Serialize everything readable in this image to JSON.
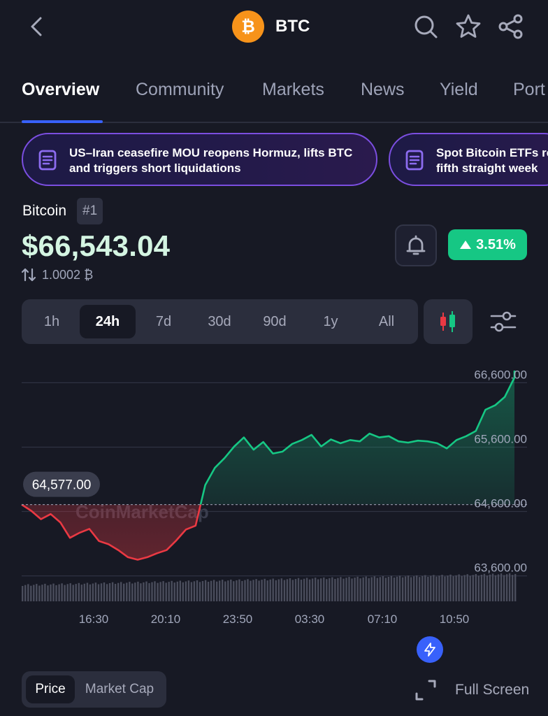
{
  "header": {
    "coin_symbol": "BTC",
    "icons": [
      "back-arrow-icon",
      "bitcoin-logo-icon",
      "search-icon",
      "star-icon",
      "share-icon"
    ]
  },
  "tabs": [
    {
      "label": "Overview",
      "active": true
    },
    {
      "label": "Community"
    },
    {
      "label": "Markets"
    },
    {
      "label": "News"
    },
    {
      "label": "Yield"
    },
    {
      "label": "Port"
    }
  ],
  "news": [
    {
      "line1": "US–Iran ceasefire MOU reopens Hormuz, lifts BTC",
      "line2": "and triggers short liquidations"
    },
    {
      "line1": "Spot Bitcoin ETFs re",
      "line2": "fifth straight week"
    }
  ],
  "coin": {
    "name": "Bitcoin",
    "rank": "#1",
    "price": "$66,543.04",
    "btc_value": "1.0002 ₿",
    "change": "3.51%",
    "change_color": "#16c784"
  },
  "ranges": [
    {
      "label": "1h"
    },
    {
      "label": "24h",
      "active": true
    },
    {
      "label": "7d"
    },
    {
      "label": "30d"
    },
    {
      "label": "90d"
    },
    {
      "label": "1y"
    },
    {
      "label": "All"
    }
  ],
  "chart": {
    "watermark": "CoinMarketCap",
    "marker_label": "64,577.00",
    "ylabels": [
      "66,600.00",
      "65,600.00",
      "64,600.00",
      "63,600.00"
    ],
    "xlabels": [
      "16:30",
      "20:10",
      "23:50",
      "03:30",
      "07:10",
      "10:50"
    ]
  },
  "chart_data": {
    "type": "line",
    "title": "",
    "xlabel": "",
    "ylabel": "",
    "ylim": [
      63400,
      66800
    ],
    "baseline": 64577,
    "up_color": "#16c784",
    "down_color": "#ea3943",
    "x": [
      "14:00",
      "14:30",
      "15:00",
      "15:30",
      "16:00",
      "16:30",
      "17:00",
      "17:30",
      "18:00",
      "18:30",
      "19:00",
      "19:30",
      "20:00",
      "20:10",
      "20:30",
      "21:00",
      "21:30",
      "22:00",
      "22:20",
      "22:30",
      "23:00",
      "23:30",
      "23:50",
      "00:30",
      "01:00",
      "01:30",
      "02:00",
      "02:30",
      "03:00",
      "03:30",
      "04:00",
      "04:30",
      "05:00",
      "05:30",
      "06:00",
      "06:30",
      "07:00",
      "07:10",
      "07:30",
      "08:00",
      "08:30",
      "09:00",
      "09:30",
      "10:00",
      "10:30",
      "10:50",
      "11:00",
      "11:30",
      "12:00",
      "12:30",
      "13:00",
      "13:30"
    ],
    "values": [
      64577,
      64480,
      64350,
      64430,
      64300,
      64060,
      64140,
      64200,
      64010,
      63960,
      63870,
      63760,
      63720,
      63760,
      63820,
      63870,
      64020,
      64190,
      64250,
      64880,
      65150,
      65300,
      65480,
      65620,
      65430,
      65550,
      65370,
      65400,
      65520,
      65580,
      65660,
      65480,
      65590,
      65530,
      65580,
      65560,
      65680,
      65620,
      65640,
      65560,
      65540,
      65570,
      65560,
      65530,
      65450,
      65580,
      65640,
      65720,
      66050,
      66120,
      66250,
      66550
    ],
    "volume_note": "volume bars shown below line"
  },
  "bottom": {
    "toggle": [
      {
        "label": "Price",
        "active": true
      },
      {
        "label": "Market Cap"
      }
    ],
    "fullscreen_label": "Full Screen"
  }
}
